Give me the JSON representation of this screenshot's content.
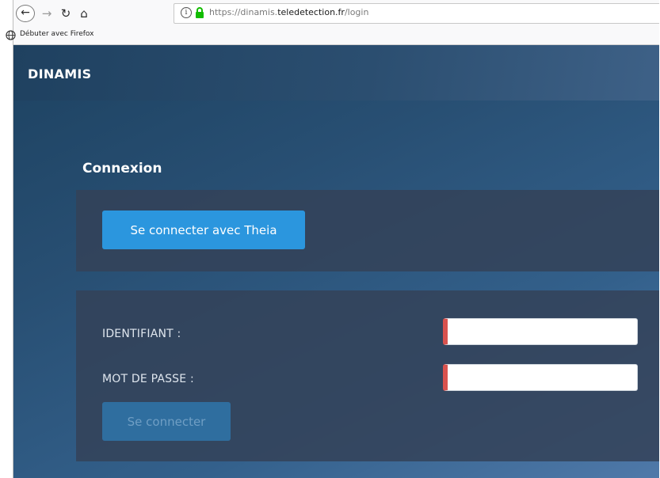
{
  "browser": {
    "url_prefix": "https://dinamis.",
    "url_domain": "teledetection.fr",
    "url_path": "/login",
    "bookmark_label": "Débuter avec Firefox",
    "icons": [
      "back-arrow-icon",
      "forward-arrow-icon",
      "reload-icon",
      "home-icon",
      "info-icon",
      "lock-icon",
      "globe-icon"
    ],
    "lock_color": "#12bc00"
  },
  "site": {
    "brand": "DINAMIS",
    "login_title": "Connexion",
    "theia_button_label": "Se connecter avec Theia",
    "form": {
      "username_label": "IDENTIFIANT :",
      "username_value": "",
      "password_label": "MOT DE PASSE :",
      "password_value": "",
      "submit_label": "Se connecter"
    },
    "colors": {
      "primary_button": "#2b96de",
      "disabled_button": "#2f6e9f",
      "required_marker": "#d9534f"
    }
  }
}
